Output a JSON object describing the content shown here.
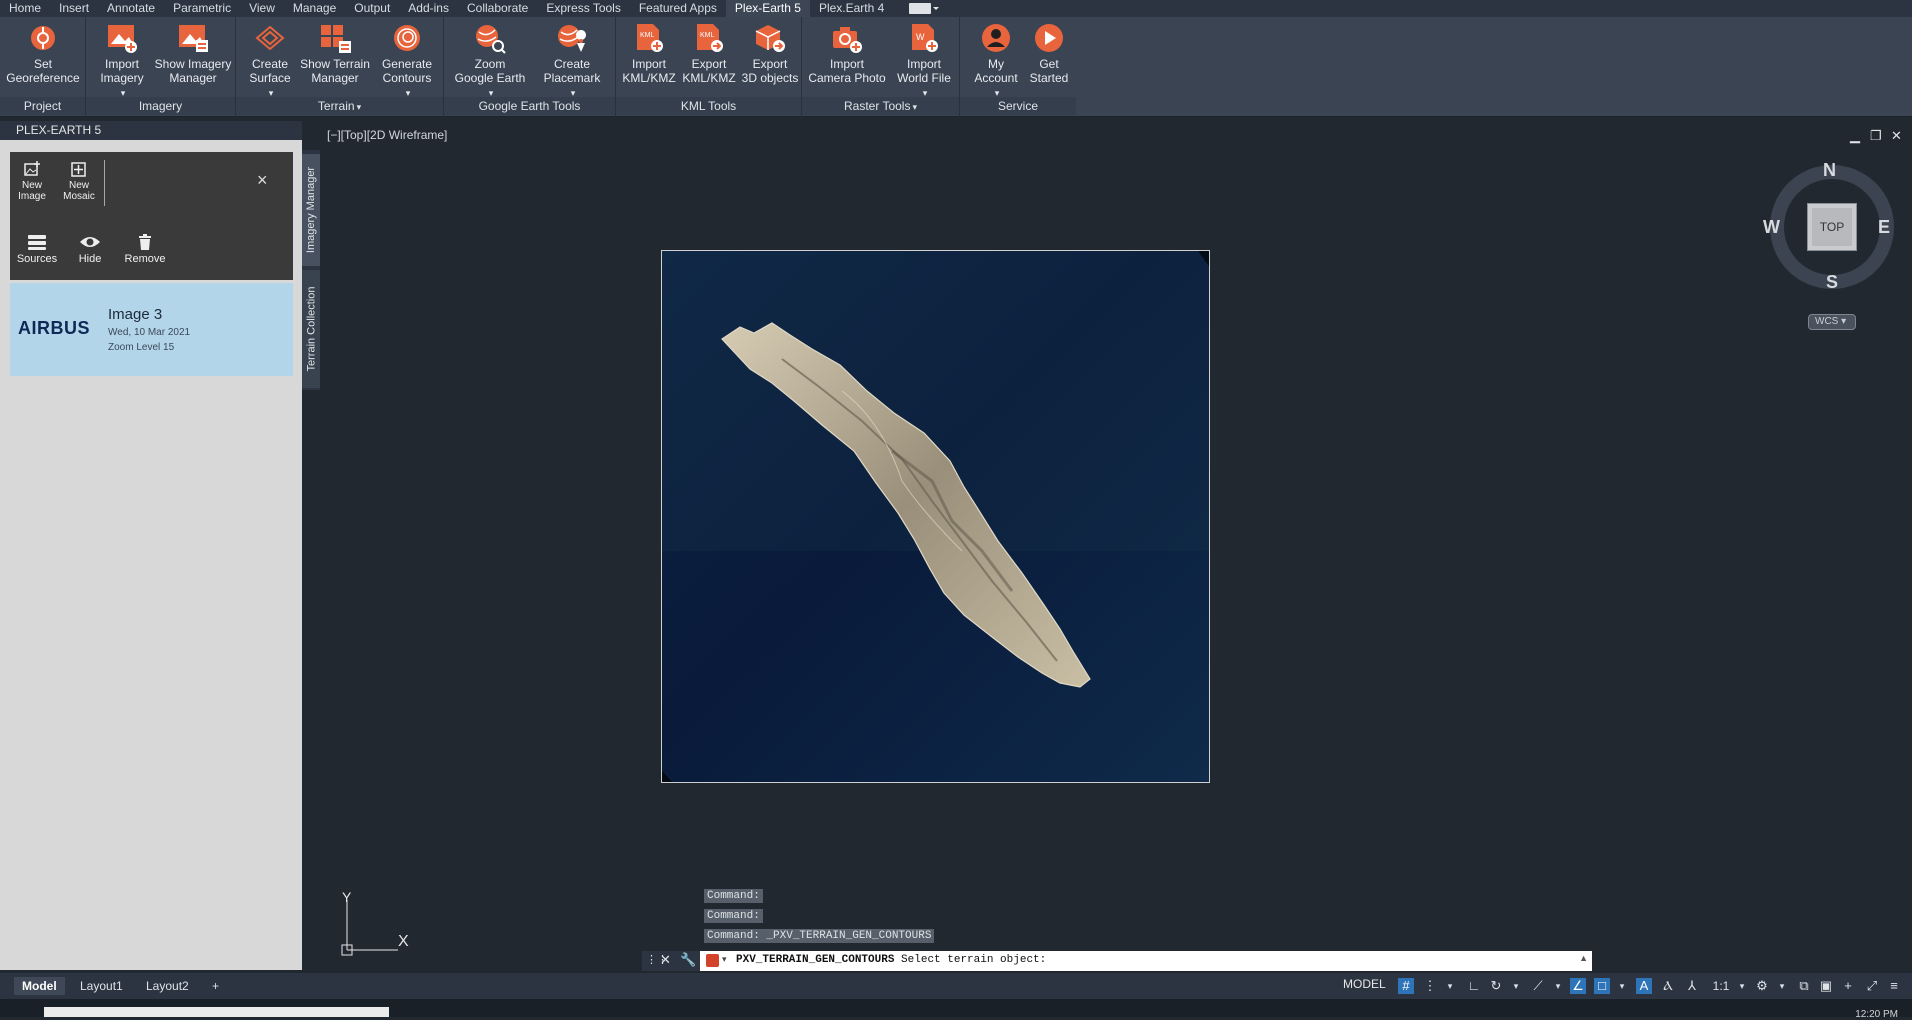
{
  "tabs": [
    "Home",
    "Insert",
    "Annotate",
    "Parametric",
    "View",
    "Manage",
    "Output",
    "Add-ins",
    "Collaborate",
    "Express Tools",
    "Featured Apps",
    "Plex-Earth 5",
    "Plex.Earth 4"
  ],
  "active_tab": "Plex-Earth 5",
  "ribbon": {
    "project": {
      "title": "Project",
      "set_georef": "Set\nGeoreference"
    },
    "imagery": {
      "title": "Imagery",
      "import_imagery": "Import\nImagery",
      "show_imagery_manager": "Show Imagery\nManager"
    },
    "terrain": {
      "title": "Terrain",
      "create_surface": "Create\nSurface",
      "show_terrain_manager": "Show Terrain\nManager",
      "generate_contours": "Generate\nContours"
    },
    "google_earth": {
      "title": "Google Earth Tools",
      "zoom_google_earth": "Zoom\nGoogle Earth",
      "create_placemark": "Create\nPlacemark"
    },
    "kml": {
      "title": "KML Tools",
      "import_kml": "Import\nKML/KMZ",
      "export_kml": "Export\nKML/KMZ",
      "export_3d": "Export\n3D objects"
    },
    "raster": {
      "title": "Raster Tools",
      "import_camera": "Import\nCamera Photo",
      "import_world": "Import\nWorld File"
    },
    "service": {
      "title": "Service",
      "my_account": "My\nAccount",
      "get_started": "Get\nStarted"
    }
  },
  "palette": {
    "title": "PLEX-EARTH 5",
    "new_image": "New\nImage",
    "new_mosaic": "New\nMosaic",
    "sources": "Sources",
    "hide": "Hide",
    "remove": "Remove",
    "close": "×",
    "vtab_imagery": "Imagery Manager",
    "vtab_terrain": "Terrain Collection",
    "item": {
      "provider": "AIRBUS",
      "title": "Image 3",
      "date": "Wed, 10 Mar 2021",
      "zoom": "Zoom Level 15"
    }
  },
  "viewport": {
    "label": "[−][Top][2D Wireframe]",
    "viewcube": {
      "n": "N",
      "s": "S",
      "e": "E",
      "w": "W",
      "top": "TOP",
      "wcs": "WCS"
    },
    "ucs": {
      "y": "Y",
      "x": "X"
    }
  },
  "command": {
    "history": [
      "Command:",
      "Command:",
      "Command: _PXV_TERRAIN_GEN_CONTOURS"
    ],
    "prompt_cmd": "PXV_TERRAIN_GEN_CONTOURS",
    "prompt_msg": " Select terrain object:"
  },
  "status": {
    "layouts": [
      "Model",
      "Layout1",
      "Layout2"
    ],
    "add": "+",
    "model": "MODEL",
    "scale": "1:1",
    "clock": "12:20 PM"
  },
  "colors": {
    "accent": "#e8643c",
    "ribbon_bg": "#3b4453",
    "canvas_bg": "#212830"
  }
}
